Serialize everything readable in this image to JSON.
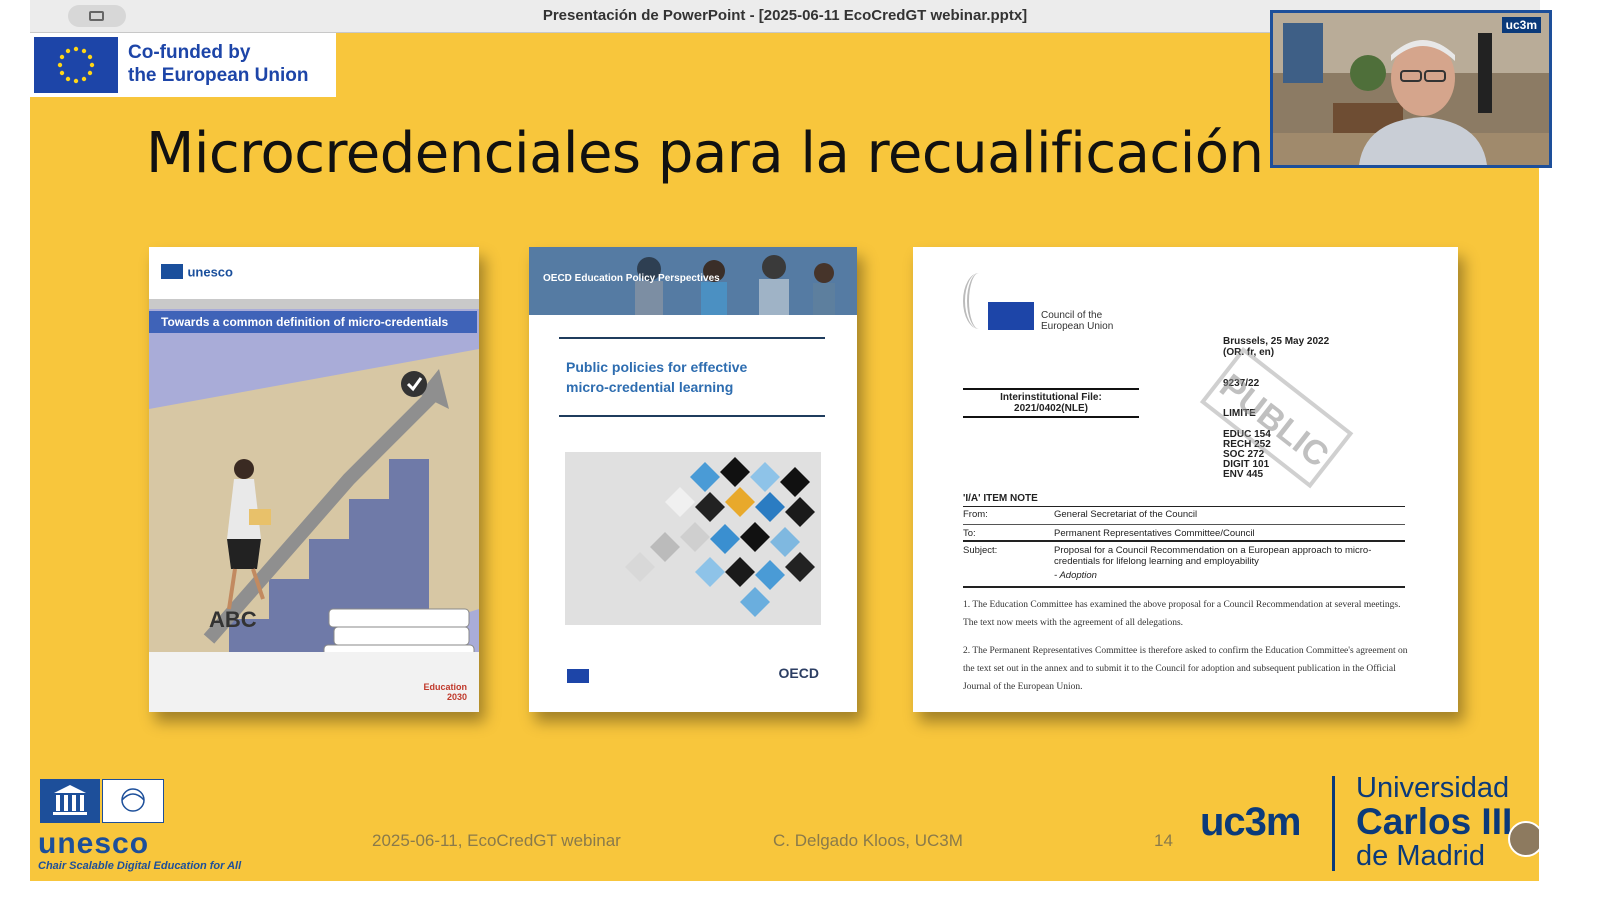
{
  "window": {
    "title": "Presentación de PowerPoint - [2025-06-11 EcoCredGT webinar.pptx]"
  },
  "slide": {
    "funding": {
      "line1": "Co-funded by",
      "line2": "the European Union"
    },
    "title": "Microcredenciales para la recualificación",
    "doc_unesco": {
      "brand": "unesco",
      "banner": "Towards a common definition of micro-credentials",
      "letters": "ABC",
      "logo": "Education 2030"
    },
    "doc_oecd": {
      "series": "OECD Education Policy Perspectives",
      "title_line1": "Public policies for effective",
      "title_line2": "micro-credential learning",
      "logo": "OECD"
    },
    "doc_council": {
      "org_line1": "Council of the",
      "org_line2": "European Union",
      "place_date": "Brussels, 25 May 2022",
      "lang": "(OR. fr, en)",
      "number": "9237/22",
      "file_label": "Interinstitutional File:",
      "file_number": "2021/0402(NLE)",
      "limite": "LIMITE",
      "codes": [
        "EDUC 154",
        "RECH 252",
        "SOC 272",
        "DIGIT 101",
        "ENV 445"
      ],
      "stamp": "PUBLIC",
      "note_title": "'I/A' ITEM NOTE",
      "from_label": "From:",
      "from_value": "General Secretariat of the Council",
      "to_label": "To:",
      "to_value": "Permanent Representatives Committee/Council",
      "subject_label": "Subject:",
      "subject_value": "Proposal for a Council Recommendation on a European approach to micro-credentials for lifelong learning and employability",
      "adoption": "- Adoption",
      "para1": "1. The Education Committee has examined the above proposal for a Council Recommendation at several meetings. The text now meets with the agreement of all delegations.",
      "para2": "2. The Permanent Representatives Committee is therefore asked to confirm the Education Committee's agreement on the text set out in the annex and to submit it to the Council for adoption and subsequent publication in the Official Journal of the European Union."
    },
    "footer": {
      "unesco_word": "unesco",
      "unesco_chair": "Chair Scalable Digital Education for All",
      "date_event": "2025-06-11, EcoCredGT webinar",
      "author": "C. Delgado Kloos, UC3M",
      "page": "14",
      "uc3m": "uc3m",
      "uni_line1": "Universidad",
      "uni_line2": "Carlos III",
      "uni_line3": "de Madrid"
    }
  },
  "webcam": {
    "badge": "uc3m"
  }
}
